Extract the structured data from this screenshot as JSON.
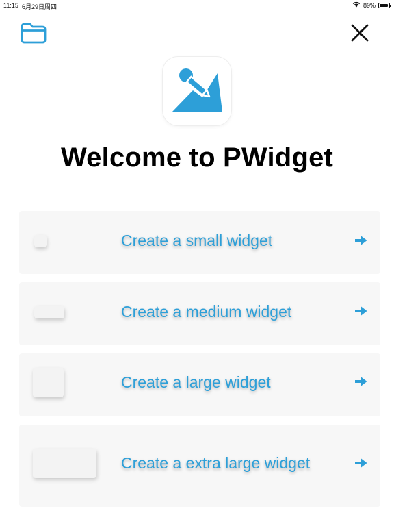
{
  "status_bar": {
    "time": "11:15",
    "date": "6月29日周四",
    "battery": "89%",
    "battery_level": 0.89
  },
  "header": {
    "folder_icon": "folder-icon",
    "close_icon": "close-icon"
  },
  "app_icon": "pwidget-logo",
  "welcome_title": "Welcome to PWidget",
  "options": [
    {
      "label": "Create a small widget",
      "size": "small"
    },
    {
      "label": "Create a medium widget",
      "size": "medium"
    },
    {
      "label": "Create a large widget",
      "size": "large"
    },
    {
      "label": "Create a extra large widget",
      "size": "extra-large"
    }
  ],
  "colors": {
    "accent": "#2d9fd8",
    "row_background": "#f7f7f7"
  }
}
